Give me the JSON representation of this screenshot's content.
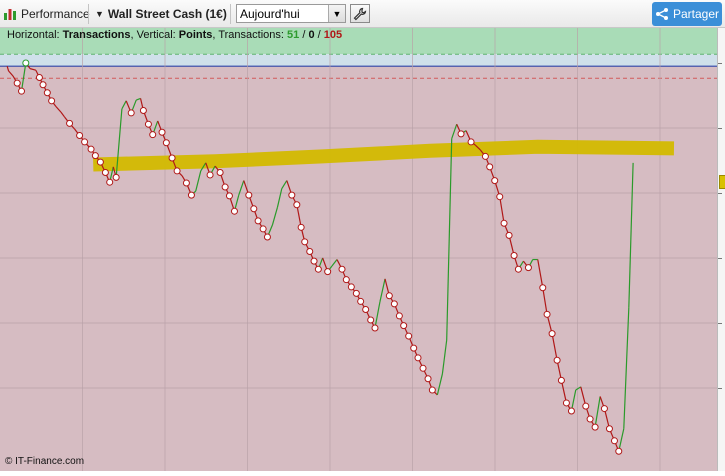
{
  "toolbar": {
    "performance_label": "Performance",
    "instrument": "Wall Street Cash (1€)",
    "period": "Aujourd'hui",
    "share_label": "Partager"
  },
  "info_bar": {
    "horizontal_prefix": "Horizontal: ",
    "horizontal_value": "Transactions",
    "vertical_prefix": ", Vertical: ",
    "vertical_value": "Points",
    "transactions_prefix": ", Transactions: ",
    "wins": "51",
    "slash1": " / ",
    "neutral": "0",
    "slash2": " / ",
    "losses": "105"
  },
  "copyright": "© IT-Finance.com",
  "colors": {
    "gain_zone": "#a9dcb7",
    "loss_zone": "#d6bcc2",
    "up_segment": "#2a9a2a",
    "down_segment": "#b01818",
    "average_band": "#d3b900",
    "zero_line": "#2e45a8",
    "share_button": "#3b8fd8"
  },
  "chart_data": {
    "type": "line",
    "xlabel": "Transactions",
    "ylabel": "Points",
    "wins": 51,
    "neutral": 0,
    "losses": 105,
    "series": [
      {
        "kind": "equity-curve",
        "points": [
          [
            0.01,
            0.0
          ],
          [
            0.012,
            -0.06
          ],
          [
            0.018,
            -0.12
          ],
          [
            0.024,
            -0.21
          ],
          [
            0.03,
            -0.31
          ],
          [
            0.036,
            0.04
          ],
          [
            0.042,
            -0.03
          ],
          [
            0.05,
            -0.05
          ],
          [
            0.055,
            -0.14
          ],
          [
            0.06,
            -0.23
          ],
          [
            0.066,
            -0.33
          ],
          [
            0.072,
            -0.43
          ],
          [
            0.078,
            -0.5
          ],
          [
            0.085,
            -0.57
          ],
          [
            0.09,
            -0.63
          ],
          [
            0.097,
            -0.71
          ],
          [
            0.104,
            -0.78
          ],
          [
            0.111,
            -0.86
          ],
          [
            0.118,
            -0.94
          ],
          [
            0.127,
            -1.03
          ],
          [
            0.133,
            -1.11
          ],
          [
            0.14,
            -1.19
          ],
          [
            0.147,
            -1.32
          ],
          [
            0.153,
            -1.44
          ],
          [
            0.158,
            -1.25
          ],
          [
            0.162,
            -1.38
          ],
          [
            0.17,
            -0.53
          ],
          [
            0.176,
            -0.43
          ],
          [
            0.183,
            -0.58
          ],
          [
            0.19,
            -0.42
          ],
          [
            0.196,
            -0.4
          ],
          [
            0.2,
            -0.55
          ],
          [
            0.207,
            -0.72
          ],
          [
            0.213,
            -0.85
          ],
          [
            0.22,
            -0.68
          ],
          [
            0.226,
            -0.82
          ],
          [
            0.232,
            -0.95
          ],
          [
            0.24,
            -1.14
          ],
          [
            0.247,
            -1.3
          ],
          [
            0.254,
            -1.36
          ],
          [
            0.26,
            -1.45
          ],
          [
            0.267,
            -1.6
          ],
          [
            0.273,
            -1.55
          ],
          [
            0.28,
            -1.3
          ],
          [
            0.287,
            -1.2
          ],
          [
            0.293,
            -1.35
          ],
          [
            0.3,
            -1.24
          ],
          [
            0.307,
            -1.32
          ],
          [
            0.314,
            -1.5
          ],
          [
            0.32,
            -1.61
          ],
          [
            0.327,
            -1.8
          ],
          [
            0.333,
            -1.6
          ],
          [
            0.34,
            -1.42
          ],
          [
            0.347,
            -1.6
          ],
          [
            0.354,
            -1.77
          ],
          [
            0.36,
            -1.92
          ],
          [
            0.367,
            -2.02
          ],
          [
            0.373,
            -2.12
          ],
          [
            0.38,
            -1.97
          ],
          [
            0.387,
            -1.75
          ],
          [
            0.393,
            -1.52
          ],
          [
            0.4,
            -1.42
          ],
          [
            0.407,
            -1.6
          ],
          [
            0.414,
            -1.72
          ],
          [
            0.42,
            -2.0
          ],
          [
            0.425,
            -2.18
          ],
          [
            0.432,
            -2.3
          ],
          [
            0.438,
            -2.42
          ],
          [
            0.444,
            -2.52
          ],
          [
            0.45,
            -2.38
          ],
          [
            0.457,
            -2.55
          ],
          [
            0.463,
            -2.48
          ],
          [
            0.47,
            -2.4
          ],
          [
            0.477,
            -2.52
          ],
          [
            0.483,
            -2.65
          ],
          [
            0.49,
            -2.74
          ],
          [
            0.497,
            -2.82
          ],
          [
            0.503,
            -2.92
          ],
          [
            0.51,
            -3.02
          ],
          [
            0.517,
            -3.15
          ],
          [
            0.523,
            -3.25
          ],
          [
            0.53,
            -2.92
          ],
          [
            0.537,
            -2.64
          ],
          [
            0.543,
            -2.85
          ],
          [
            0.55,
            -2.95
          ],
          [
            0.557,
            -3.1
          ],
          [
            0.563,
            -3.22
          ],
          [
            0.57,
            -3.35
          ],
          [
            0.577,
            -3.5
          ],
          [
            0.583,
            -3.62
          ],
          [
            0.59,
            -3.75
          ],
          [
            0.597,
            -3.88
          ],
          [
            0.603,
            -4.02
          ],
          [
            0.61,
            -4.08
          ],
          [
            0.617,
            -3.82
          ],
          [
            0.623,
            -3.4
          ],
          [
            0.63,
            -0.9
          ],
          [
            0.637,
            -0.72
          ],
          [
            0.643,
            -0.84
          ],
          [
            0.65,
            -0.8
          ],
          [
            0.657,
            -0.94
          ],
          [
            0.663,
            -0.98
          ],
          [
            0.67,
            -1.04
          ],
          [
            0.677,
            -1.12
          ],
          [
            0.683,
            -1.25
          ],
          [
            0.69,
            -1.42
          ],
          [
            0.697,
            -1.62
          ],
          [
            0.703,
            -1.95
          ],
          [
            0.71,
            -2.1
          ],
          [
            0.717,
            -2.35
          ],
          [
            0.723,
            -2.52
          ],
          [
            0.73,
            -2.42
          ],
          [
            0.737,
            -2.5
          ],
          [
            0.743,
            -2.4
          ],
          [
            0.75,
            -2.4
          ],
          [
            0.757,
            -2.75
          ],
          [
            0.763,
            -3.08
          ],
          [
            0.77,
            -3.32
          ],
          [
            0.777,
            -3.65
          ],
          [
            0.783,
            -3.9
          ],
          [
            0.79,
            -4.18
          ],
          [
            0.797,
            -4.28
          ],
          [
            0.803,
            -4.02
          ],
          [
            0.81,
            -3.98
          ],
          [
            0.817,
            -4.22
          ],
          [
            0.823,
            -4.38
          ],
          [
            0.83,
            -4.48
          ],
          [
            0.837,
            -4.1
          ],
          [
            0.843,
            -4.25
          ],
          [
            0.85,
            -4.5
          ],
          [
            0.857,
            -4.65
          ],
          [
            0.863,
            -4.78
          ],
          [
            0.87,
            -4.5
          ],
          [
            0.877,
            -3.0
          ],
          [
            0.883,
            -1.2
          ]
        ]
      }
    ],
    "average_band": [
      [
        0.13,
        -1.22
      ],
      [
        0.3,
        -1.18
      ],
      [
        0.45,
        -1.12
      ],
      [
        0.6,
        -1.05
      ],
      [
        0.75,
        -1.0
      ],
      [
        0.94,
        -1.02
      ]
    ],
    "zero_level": 0,
    "ylim": [
      -5.0,
      0.35
    ],
    "grid": true
  }
}
